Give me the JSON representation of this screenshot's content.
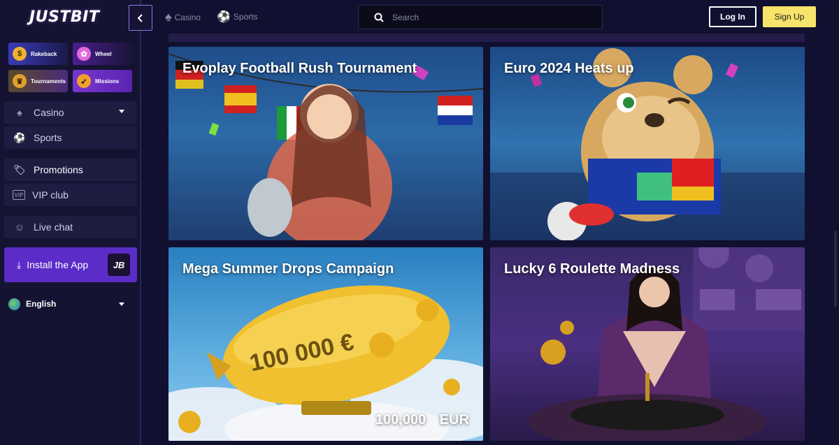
{
  "brand": {
    "logo": "JUSTBIT"
  },
  "quick_links": [
    {
      "label": "Rakeback",
      "icon": "coins-icon"
    },
    {
      "label": "Wheel",
      "icon": "wheel-icon"
    },
    {
      "label": "Tournaments",
      "icon": "trophy-icon"
    },
    {
      "label": "Missions",
      "icon": "rocket-icon"
    }
  ],
  "nav": {
    "casino": "Casino",
    "sports": "Sports",
    "promotions": "Promotions",
    "vip": "VIP club",
    "live_chat": "Live chat",
    "install": "Install the App",
    "install_badge": "JB",
    "language": "English"
  },
  "header": {
    "casino": "Casino",
    "sports": "Sports",
    "search_placeholder": "Search",
    "login": "Log In",
    "signup": "Sign Up"
  },
  "promotions": [
    {
      "title": "Evoplay Football Rush Tournament"
    },
    {
      "title": "Euro 2024 Heats up"
    },
    {
      "title": "Mega Summer Drops Campaign",
      "prize_amount": "100,000",
      "prize_currency": "EUR",
      "blimp_text": "100 000 €"
    },
    {
      "title": "Lucky 6 Roulette Madness"
    }
  ],
  "colors": {
    "accent": "#5b2cc8",
    "signup": "#f7e46b",
    "background": "#121030"
  }
}
